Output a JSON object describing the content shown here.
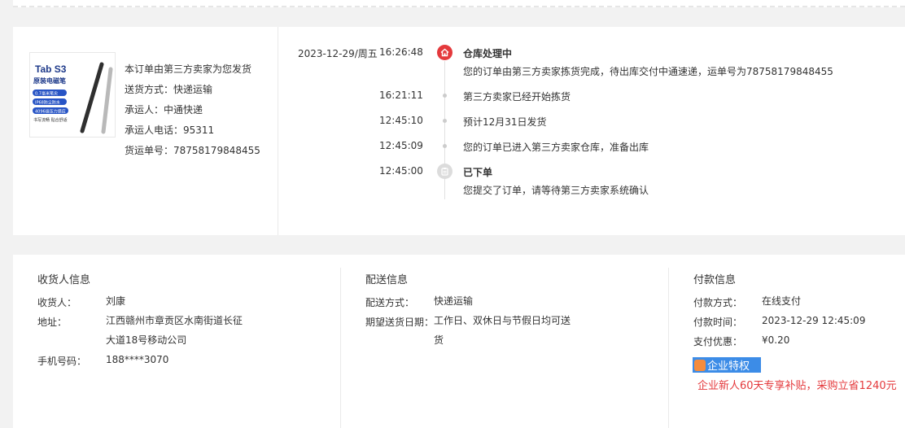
{
  "product": {
    "image_text": {
      "title": "Tab S3",
      "subtitle": "原装电磁笔",
      "tags": [
        "0.7毫米笔尖",
        "IP68防尘防水",
        "4096级压力感应"
      ],
      "footer": "书写流畅 贴合舒适"
    }
  },
  "shipping_summary": {
    "lines": [
      "本订单由第三方卖家为您发货",
      "送货方式：快递运输",
      "承运人：中通快递",
      "承运人电话：95311",
      "货运单号：78758179848455"
    ]
  },
  "timeline": [
    {
      "date": "2023-12-29/周五",
      "time": "16:26:48",
      "title": "仓库处理中",
      "text": "您的订单由第三方卖家拣货完成，待出库交付中通速递，运单号为78758179848455",
      "marker": "home-icon"
    },
    {
      "date": "",
      "time": "16:21:11",
      "title": "",
      "text": "第三方卖家已经开始拣货",
      "marker": "dot"
    },
    {
      "date": "",
      "time": "12:45:10",
      "title": "",
      "text": "预计12月31日发货",
      "marker": "dot"
    },
    {
      "date": "",
      "time": "12:45:09",
      "title": "",
      "text": "您的订单已进入第三方卖家仓库，准备出库",
      "marker": "dot"
    },
    {
      "date": "",
      "time": "12:45:00",
      "title": "已下单",
      "text": "您提交了订单，请等待第三方卖家系统确认",
      "marker": "clipboard-icon"
    }
  ],
  "consignee": {
    "title": "收货人信息",
    "name_label": "收货人：",
    "name": "刘康",
    "address_label": "地址：",
    "address_line1": "江西赣州市章贡区水南街道长征",
    "address_line2": "大道18号移动公司",
    "phone_label": "手机号码：",
    "phone": "188****3070"
  },
  "delivery": {
    "title": "配送信息",
    "method_label": "配送方式：",
    "method": "快递运输",
    "date_label": "期望送货日期：",
    "date_line1": "工作日、双休日与节假日均可送",
    "date_line2": "货"
  },
  "payment": {
    "title": "付款信息",
    "method_label": "付款方式：",
    "method": "在线支付",
    "time_label": "付款时间：",
    "time": "2023-12-29 12:45:09",
    "discount_label": "支付优惠：",
    "discount": "¥0.20",
    "badge": "企业特权",
    "promo": "企业新人60天专享补贴，采购立省1240元"
  },
  "colors": {
    "accent_red": "#e4393c",
    "badge_blue": "#3c8ce7"
  }
}
